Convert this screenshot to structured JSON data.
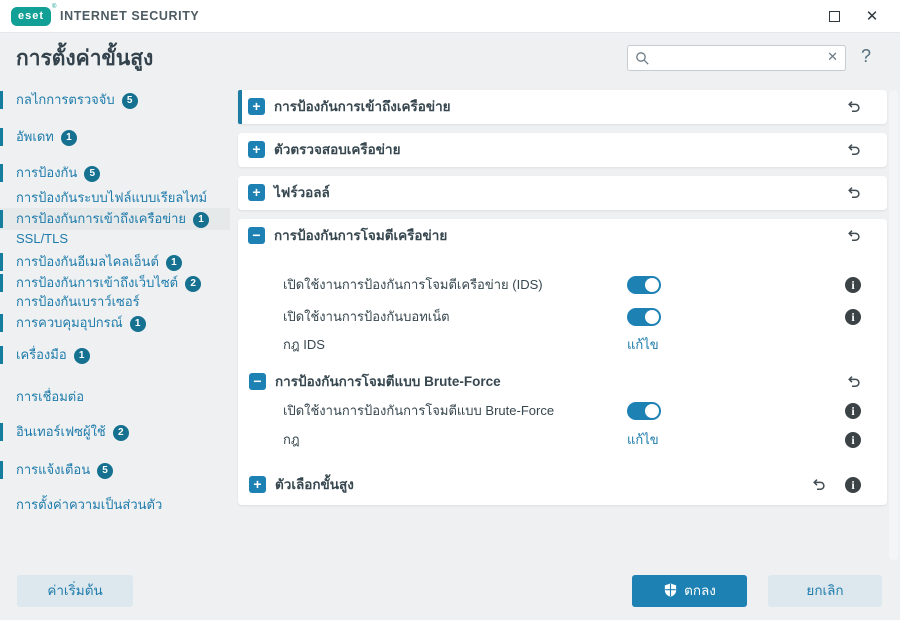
{
  "window": {
    "brand": "eset",
    "registered": "®",
    "app_title": "INTERNET SECURITY",
    "close_glyph": "✕"
  },
  "header": {
    "page_title": "การตั้งค่าขั้นสูง",
    "search_value": "",
    "search_clear_glyph": "✕",
    "help_glyph": "?"
  },
  "sidebar": {
    "items": [
      {
        "label": "กลไกการตรวจจับ",
        "badge": "5"
      },
      {
        "label": "อัพเดท",
        "badge": "1"
      },
      {
        "label": "การป้องกัน",
        "badge": "5"
      },
      {
        "label": "การป้องกันระบบไฟล์แบบเรียลไทม์"
      },
      {
        "label": "การป้องกันการเข้าถึงเครือข่าย",
        "badge": "1",
        "selected": true
      },
      {
        "label": "SSL/TLS"
      },
      {
        "label": "การป้องกันอีเมลไคลเอ็นต์",
        "badge": "1"
      },
      {
        "label": "การป้องกันการเข้าถึงเว็บไซต์",
        "badge": "2"
      },
      {
        "label": "การป้องกันเบราว์เซอร์"
      },
      {
        "label": "การควบคุมอุปกรณ์",
        "badge": "1"
      },
      {
        "label": "เครื่องมือ",
        "badge": "1"
      },
      {
        "label": "การเชื่อมต่อ"
      },
      {
        "label": "อินเทอร์เฟซผู้ใช้",
        "badge": "2"
      },
      {
        "label": "การแจ้งเตือน",
        "badge": "5"
      },
      {
        "label": "การตั้งค่าความเป็นส่วนตัว"
      }
    ],
    "default_button": "ค่าเริ่มต้น"
  },
  "content": {
    "edit_label": "แก้ไข",
    "panels": [
      {
        "title": "การป้องกันการเข้าถึงเครือข่าย",
        "expander": "+"
      },
      {
        "title": "ตัวตรวจสอบเครือข่าย",
        "expander": "+"
      },
      {
        "title": "ไฟร์วอลล์",
        "expander": "+"
      },
      {
        "title": "การป้องกันการโจมตีเครือข่าย",
        "expander": "−",
        "rows": [
          {
            "label": "เปิดใช้งานการป้องกันการโจมตีเครือข่าย (IDS)",
            "control": "toggle",
            "value": "on",
            "info": true
          },
          {
            "label": "เปิดใช้งานการป้องกันบอทเน็ต",
            "control": "toggle",
            "value": "on",
            "info": true
          },
          {
            "label": "กฎ IDS",
            "control": "edit-link"
          },
          {
            "label": "การป้องกันการโจมตีแบบ Brute-Force",
            "control": "subheader",
            "expander": "−"
          },
          {
            "label": "เปิดใช้งานการป้องกันการโจมตีแบบ Brute-Force",
            "control": "toggle",
            "value": "on",
            "info": true
          },
          {
            "label": "กฎ",
            "control": "edit-link",
            "info": true
          },
          {
            "label": "ตัวเลือกขั้นสูง",
            "control": "collapsed-subsection",
            "expander": "+",
            "info": true
          }
        ]
      }
    ]
  },
  "footer": {
    "ok_label": "ตกลง",
    "cancel_label": "ยกเลิก"
  },
  "colors": {
    "brand_teal": "#12a096",
    "accent_blue": "#1e81b4",
    "link_blue": "#1e7bab",
    "badge_blue": "#15718f",
    "text_dark": "#37474f",
    "background": "#eef0f1"
  }
}
